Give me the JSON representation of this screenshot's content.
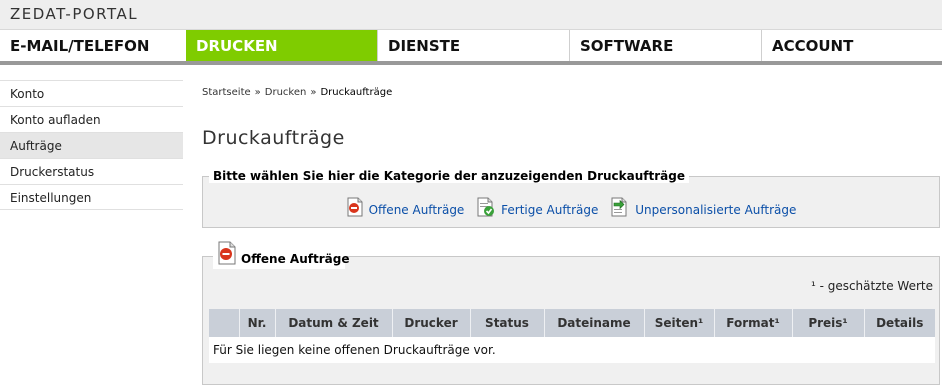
{
  "header": {
    "portal_title": "ZEDAT-PORTAL"
  },
  "nav": {
    "items": [
      {
        "label": "E-MAIL/TELEFON"
      },
      {
        "label": "DRUCKEN"
      },
      {
        "label": "DIENSTE"
      },
      {
        "label": "SOFTWARE"
      },
      {
        "label": "ACCOUNT"
      }
    ],
    "active": "DRUCKEN"
  },
  "sidebar": {
    "items": [
      {
        "label": "Konto"
      },
      {
        "label": "Konto aufladen"
      },
      {
        "label": "Aufträge"
      },
      {
        "label": "Druckerstatus"
      },
      {
        "label": "Einstellungen"
      }
    ],
    "active": "Aufträge"
  },
  "breadcrumb": {
    "items": [
      "Startseite",
      "Drucken",
      "Druckaufträge"
    ],
    "separator": "»"
  },
  "page_title": "Druckaufträge",
  "category": {
    "legend": "Bitte wählen Sie hier die Kategorie der anzuzeigenden Druckaufträge",
    "links": [
      {
        "label": "Offene Aufträge",
        "icon": "document-open-icon"
      },
      {
        "label": "Fertige Aufträge",
        "icon": "document-done-icon"
      },
      {
        "label": "Unpersonalisierte Aufträge",
        "icon": "document-forward-icon"
      }
    ]
  },
  "jobs": {
    "legend": "Offene Aufträge",
    "estimate_note": "¹ - geschätzte Werte",
    "columns": [
      "Nr.",
      "Datum & Zeit",
      "Drucker",
      "Status",
      "Dateiname",
      "Seiten¹",
      "Format¹",
      "Preis¹",
      "Details"
    ],
    "empty_message": "Für Sie liegen keine offenen Druckaufträge vor."
  },
  "colors": {
    "accent_green": "#7fcc00",
    "link_blue": "#0b4fa8",
    "table_header": "#c9cfd8"
  }
}
